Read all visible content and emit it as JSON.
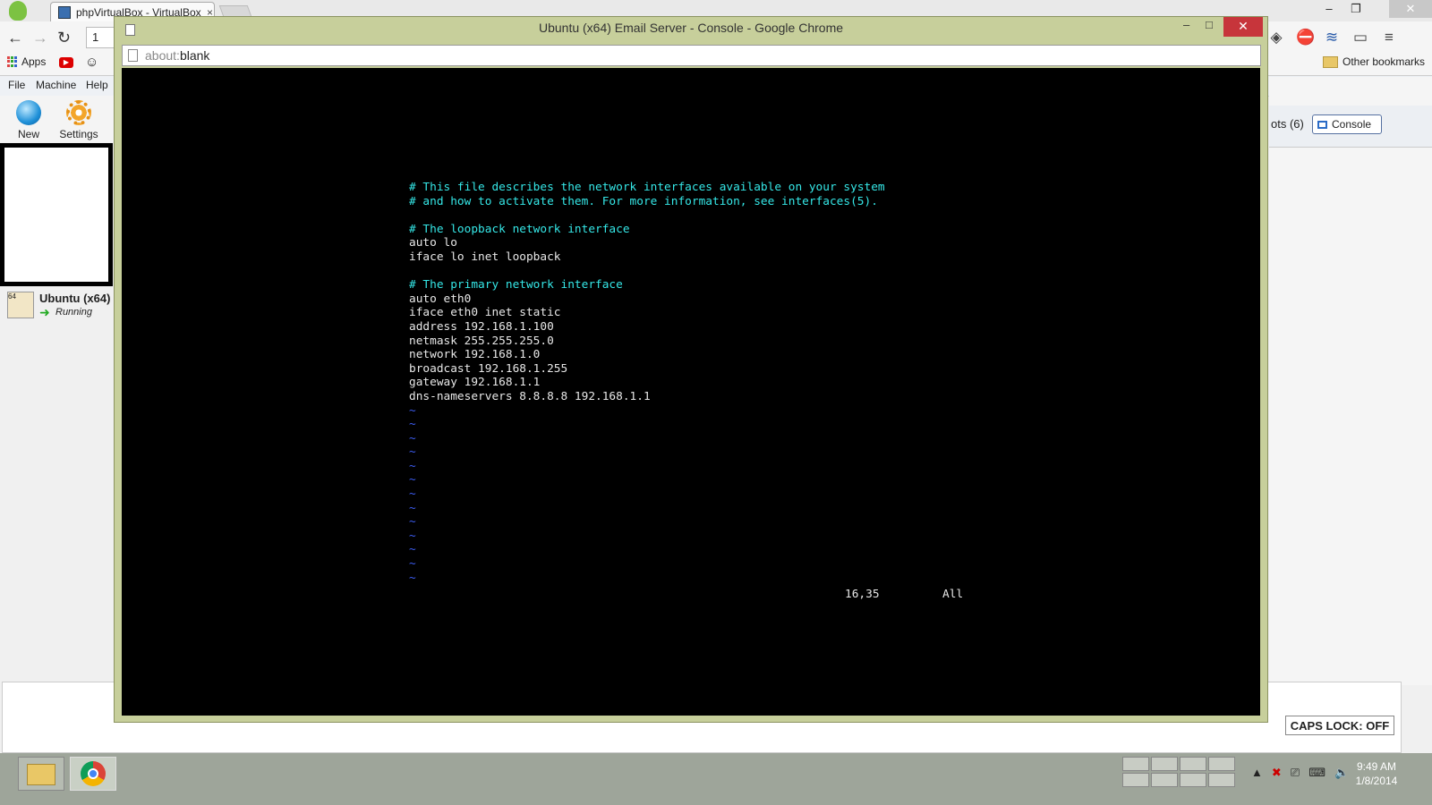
{
  "outer_browser": {
    "tab_title": "phpVirtualBox - VirtualBox",
    "tab_close": "×",
    "window_controls": [
      "–",
      "❐",
      "✕"
    ],
    "nav": {
      "back": "←",
      "forward": "→",
      "reload": "↻"
    },
    "address_fragment": "1",
    "bookmarks": {
      "apps": "Apps",
      "other": "Other bookmarks"
    },
    "extension_icons": [
      "diamond-icon",
      "stop-icon",
      "wifi-icon",
      "cast-icon",
      "menu-icon"
    ]
  },
  "vbox": {
    "menu": [
      "File",
      "Machine",
      "Help"
    ],
    "toolbar": {
      "new_label": "New",
      "settings_label": "Settings"
    },
    "vm": {
      "name": "Ubuntu (x64)",
      "status": "Running",
      "icon_text": "64"
    },
    "right_tabs": {
      "snapshots_label": "ots (6)",
      "console_label": "Console"
    },
    "caps_lock": "CAPS LOCK: OFF"
  },
  "popup": {
    "title": "Ubuntu (x64) Email Server - Console - Google Chrome",
    "address_prefix": "about:",
    "address_page": "blank",
    "controls": {
      "minimize": "–",
      "maximize": "□",
      "close": "✕"
    }
  },
  "console": {
    "lines": [
      {
        "text": "# This file describes the network interfaces available on your system",
        "kind": "comment"
      },
      {
        "text": "# and how to activate them. For more information, see interfaces(5).",
        "kind": "comment"
      },
      {
        "text": "",
        "kind": "blank"
      },
      {
        "text": "# The loopback network interface",
        "kind": "comment"
      },
      {
        "text": "auto lo",
        "kind": "text"
      },
      {
        "text": "iface lo inet loopback",
        "kind": "text"
      },
      {
        "text": "",
        "kind": "blank"
      },
      {
        "text": "# The primary network interface",
        "kind": "comment"
      },
      {
        "text": "auto eth0",
        "kind": "text"
      },
      {
        "text": "iface eth0 inet static",
        "kind": "text"
      },
      {
        "text": "address 192.168.1.100",
        "kind": "text"
      },
      {
        "text": "netmask 255.255.255.0",
        "kind": "text"
      },
      {
        "text": "network 192.168.1.0",
        "kind": "text"
      },
      {
        "text": "broadcast 192.168.1.255",
        "kind": "text"
      },
      {
        "text": "gateway 192.168.1.1",
        "kind": "text"
      },
      {
        "text": "dns-nameservers 8.8.8.8 192.168.1.1",
        "kind": "text"
      },
      {
        "text": "~",
        "kind": "tilde"
      },
      {
        "text": "~",
        "kind": "tilde"
      },
      {
        "text": "~",
        "kind": "tilde"
      },
      {
        "text": "~",
        "kind": "tilde"
      },
      {
        "text": "~",
        "kind": "tilde"
      },
      {
        "text": "~",
        "kind": "tilde"
      },
      {
        "text": "~",
        "kind": "tilde"
      },
      {
        "text": "~",
        "kind": "tilde"
      },
      {
        "text": "~",
        "kind": "tilde"
      },
      {
        "text": "~",
        "kind": "tilde"
      },
      {
        "text": "~",
        "kind": "tilde"
      },
      {
        "text": "~",
        "kind": "tilde"
      },
      {
        "text": "~",
        "kind": "tilde"
      }
    ],
    "cursor_pos": "16,35",
    "view": "All",
    "colors": {
      "comment": "#35e7e7",
      "text": "#e8e8e8",
      "tilde": "#3c5cf0",
      "background": "#000000"
    }
  },
  "taskbar": {
    "tray_icons": [
      "▲",
      "✖",
      "⎚",
      "⌨",
      "🔈"
    ],
    "time": "9:49 AM",
    "date": "1/8/2014"
  }
}
